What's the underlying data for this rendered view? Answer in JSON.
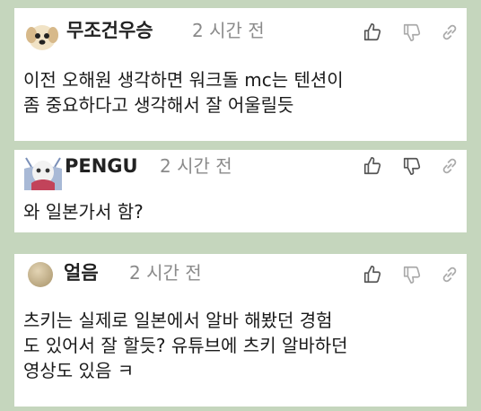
{
  "comments": [
    {
      "author": "무조건우승",
      "time": "2 시간 전",
      "lines": [
        "이전 오해원 생각하면 워크돌 mc는 텐션이",
        "좀 중요하다고 생각해서 잘 어울릴듯"
      ],
      "avatar_icon": "puppy-avatar-icon"
    },
    {
      "author": "PENGU",
      "time": "2 시간 전",
      "lines": [
        "와 일본가서 함?"
      ],
      "avatar_icon": "doll-avatar-icon"
    },
    {
      "author": "얼음",
      "time": "2 시간 전",
      "lines": [
        "츠키는 실제로 일본에서 알바 해봤던 경험",
        "도 있어서 잘 할듯? 유튜브에 츠키 알바하던",
        "영상도 있음 ㅋ"
      ],
      "avatar_icon": "circle-avatar-icon"
    }
  ],
  "actions": {
    "like_icon": "thumbs-up-icon",
    "dislike_icon": "thumbs-down-icon",
    "share_icon": "link-icon"
  },
  "colors": {
    "background": "#c5d6bd",
    "card": "#ffffff",
    "author": "#222222",
    "time": "#8a8a8a",
    "icon": "#555555"
  }
}
